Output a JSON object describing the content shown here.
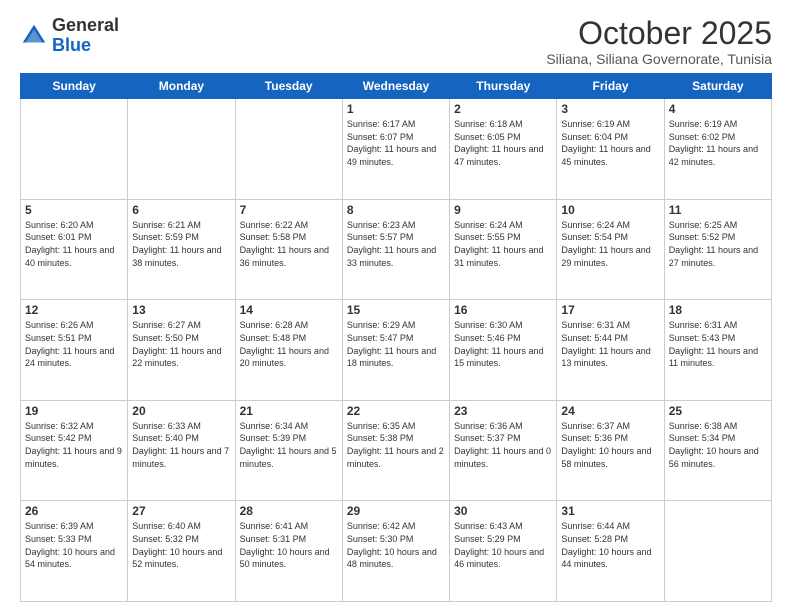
{
  "header": {
    "logo_general": "General",
    "logo_blue": "Blue",
    "month_title": "October 2025",
    "location": "Siliana, Siliana Governorate, Tunisia"
  },
  "days_of_week": [
    "Sunday",
    "Monday",
    "Tuesday",
    "Wednesday",
    "Thursday",
    "Friday",
    "Saturday"
  ],
  "weeks": [
    {
      "cells": [
        {
          "day": null,
          "sunrise": null,
          "sunset": null,
          "daylight": null
        },
        {
          "day": null,
          "sunrise": null,
          "sunset": null,
          "daylight": null
        },
        {
          "day": null,
          "sunrise": null,
          "sunset": null,
          "daylight": null
        },
        {
          "day": "1",
          "sunrise": "6:17 AM",
          "sunset": "6:07 PM",
          "daylight": "11 hours and 49 minutes."
        },
        {
          "day": "2",
          "sunrise": "6:18 AM",
          "sunset": "6:05 PM",
          "daylight": "11 hours and 47 minutes."
        },
        {
          "day": "3",
          "sunrise": "6:19 AM",
          "sunset": "6:04 PM",
          "daylight": "11 hours and 45 minutes."
        },
        {
          "day": "4",
          "sunrise": "6:19 AM",
          "sunset": "6:02 PM",
          "daylight": "11 hours and 42 minutes."
        }
      ]
    },
    {
      "cells": [
        {
          "day": "5",
          "sunrise": "6:20 AM",
          "sunset": "6:01 PM",
          "daylight": "11 hours and 40 minutes."
        },
        {
          "day": "6",
          "sunrise": "6:21 AM",
          "sunset": "5:59 PM",
          "daylight": "11 hours and 38 minutes."
        },
        {
          "day": "7",
          "sunrise": "6:22 AM",
          "sunset": "5:58 PM",
          "daylight": "11 hours and 36 minutes."
        },
        {
          "day": "8",
          "sunrise": "6:23 AM",
          "sunset": "5:57 PM",
          "daylight": "11 hours and 33 minutes."
        },
        {
          "day": "9",
          "sunrise": "6:24 AM",
          "sunset": "5:55 PM",
          "daylight": "11 hours and 31 minutes."
        },
        {
          "day": "10",
          "sunrise": "6:24 AM",
          "sunset": "5:54 PM",
          "daylight": "11 hours and 29 minutes."
        },
        {
          "day": "11",
          "sunrise": "6:25 AM",
          "sunset": "5:52 PM",
          "daylight": "11 hours and 27 minutes."
        }
      ]
    },
    {
      "cells": [
        {
          "day": "12",
          "sunrise": "6:26 AM",
          "sunset": "5:51 PM",
          "daylight": "11 hours and 24 minutes."
        },
        {
          "day": "13",
          "sunrise": "6:27 AM",
          "sunset": "5:50 PM",
          "daylight": "11 hours and 22 minutes."
        },
        {
          "day": "14",
          "sunrise": "6:28 AM",
          "sunset": "5:48 PM",
          "daylight": "11 hours and 20 minutes."
        },
        {
          "day": "15",
          "sunrise": "6:29 AM",
          "sunset": "5:47 PM",
          "daylight": "11 hours and 18 minutes."
        },
        {
          "day": "16",
          "sunrise": "6:30 AM",
          "sunset": "5:46 PM",
          "daylight": "11 hours and 15 minutes."
        },
        {
          "day": "17",
          "sunrise": "6:31 AM",
          "sunset": "5:44 PM",
          "daylight": "11 hours and 13 minutes."
        },
        {
          "day": "18",
          "sunrise": "6:31 AM",
          "sunset": "5:43 PM",
          "daylight": "11 hours and 11 minutes."
        }
      ]
    },
    {
      "cells": [
        {
          "day": "19",
          "sunrise": "6:32 AM",
          "sunset": "5:42 PM",
          "daylight": "11 hours and 9 minutes."
        },
        {
          "day": "20",
          "sunrise": "6:33 AM",
          "sunset": "5:40 PM",
          "daylight": "11 hours and 7 minutes."
        },
        {
          "day": "21",
          "sunrise": "6:34 AM",
          "sunset": "5:39 PM",
          "daylight": "11 hours and 5 minutes."
        },
        {
          "day": "22",
          "sunrise": "6:35 AM",
          "sunset": "5:38 PM",
          "daylight": "11 hours and 2 minutes."
        },
        {
          "day": "23",
          "sunrise": "6:36 AM",
          "sunset": "5:37 PM",
          "daylight": "11 hours and 0 minutes."
        },
        {
          "day": "24",
          "sunrise": "6:37 AM",
          "sunset": "5:36 PM",
          "daylight": "10 hours and 58 minutes."
        },
        {
          "day": "25",
          "sunrise": "6:38 AM",
          "sunset": "5:34 PM",
          "daylight": "10 hours and 56 minutes."
        }
      ]
    },
    {
      "cells": [
        {
          "day": "26",
          "sunrise": "6:39 AM",
          "sunset": "5:33 PM",
          "daylight": "10 hours and 54 minutes."
        },
        {
          "day": "27",
          "sunrise": "6:40 AM",
          "sunset": "5:32 PM",
          "daylight": "10 hours and 52 minutes."
        },
        {
          "day": "28",
          "sunrise": "6:41 AM",
          "sunset": "5:31 PM",
          "daylight": "10 hours and 50 minutes."
        },
        {
          "day": "29",
          "sunrise": "6:42 AM",
          "sunset": "5:30 PM",
          "daylight": "10 hours and 48 minutes."
        },
        {
          "day": "30",
          "sunrise": "6:43 AM",
          "sunset": "5:29 PM",
          "daylight": "10 hours and 46 minutes."
        },
        {
          "day": "31",
          "sunrise": "6:44 AM",
          "sunset": "5:28 PM",
          "daylight": "10 hours and 44 minutes."
        },
        {
          "day": null,
          "sunrise": null,
          "sunset": null,
          "daylight": null
        }
      ]
    }
  ]
}
